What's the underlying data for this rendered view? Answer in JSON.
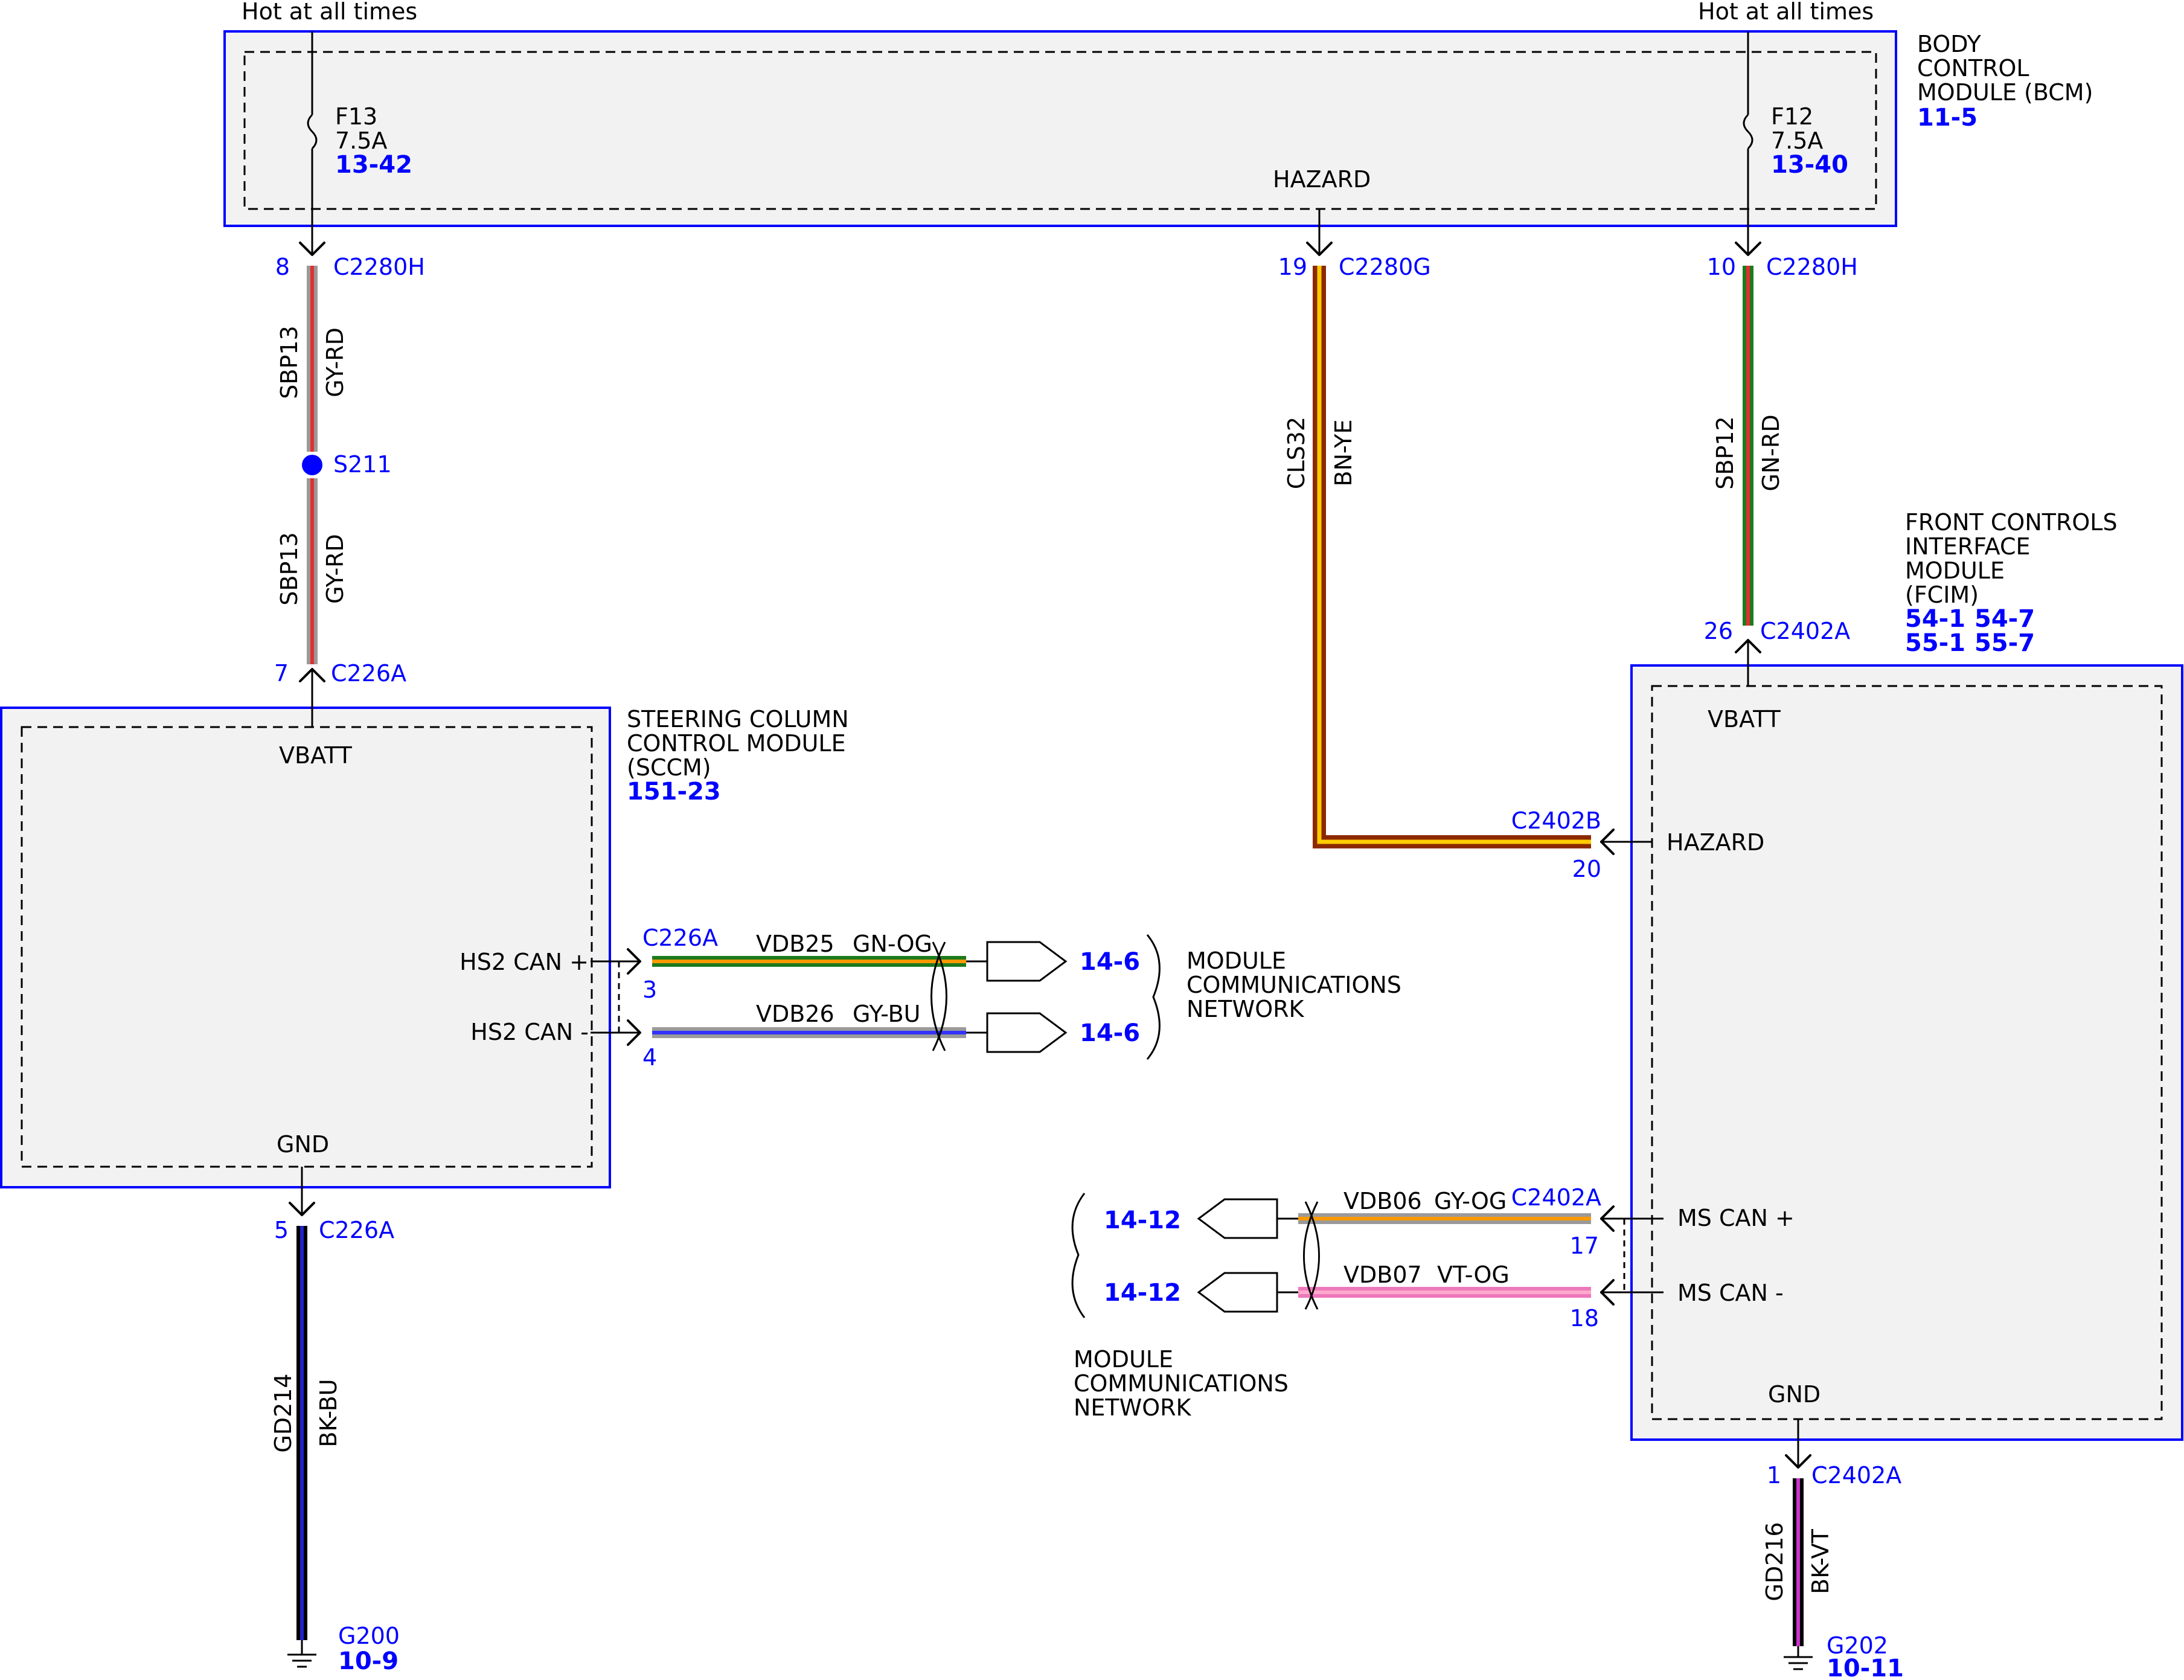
{
  "colors": {
    "module_border": "#0000ff",
    "module_fill": "#f2f2f2",
    "connector_text": "#0000ff",
    "wire_gy_rd": [
      "#9a9a9a",
      "#e03030"
    ],
    "wire_bn_ye": [
      "#8b2a00",
      "#ffcc00"
    ],
    "wire_gn_rd": [
      "#1d7a1d",
      "#e03030"
    ],
    "wire_gn_og": [
      "#1d7a1d",
      "#ff9900"
    ],
    "wire_gy_bu": [
      "#9a9a9a",
      "#3333ff"
    ],
    "wire_bk_bu": [
      "#000000",
      "#2222cc"
    ],
    "wire_gy_og": [
      "#9a9a9a",
      "#ff9900"
    ],
    "wire_vt_og": [
      "#ee77bb",
      "#ffaacc"
    ],
    "wire_bk_vt": [
      "#000000",
      "#cc33cc"
    ]
  },
  "hot_left": "Hot at all times",
  "hot_right": "Hot at all times",
  "bcm": {
    "name_l1": "BODY",
    "name_l2": "CONTROL",
    "name_l3": "MODULE (BCM)",
    "ref": "11-5",
    "fuse_left": {
      "id": "F13",
      "rating": "7.5A",
      "ref": "13-42"
    },
    "fuse_right": {
      "id": "F12",
      "rating": "7.5A",
      "ref": "13-40"
    },
    "hazard": "HAZARD"
  },
  "sccm": {
    "name_l1": "STEERING COLUMN",
    "name_l2": "CONTROL MODULE",
    "name_l3": "(SCCM)",
    "ref": "151-23",
    "vbatt": "VBATT",
    "hs2_can_plus": "HS2 CAN +",
    "hs2_can_minus": "HS2 CAN -",
    "gnd": "GND"
  },
  "fcim": {
    "name_l1": "FRONT CONTROLS",
    "name_l2": "INTERFACE",
    "name_l3": "MODULE",
    "name_l4": "(FCIM)",
    "refs": [
      "54-1",
      "54-7",
      "55-1",
      "55-7"
    ],
    "vbatt": "VBATT",
    "hazard": "HAZARD",
    "ms_can_plus": "MS CAN +",
    "ms_can_minus": "MS CAN -",
    "gnd": "GND"
  },
  "connectors": {
    "c2280h_left": {
      "pin": "8",
      "name": "C2280H"
    },
    "c2280g": {
      "pin": "19",
      "name": "C2280G"
    },
    "c2280h_right": {
      "pin": "10",
      "name": "C2280H"
    },
    "c226a_top": {
      "pin": "7",
      "name": "C226A"
    },
    "c226a_can": {
      "name": "C226A",
      "pin_plus": "3",
      "pin_minus": "4"
    },
    "c226a_gnd": {
      "pin": "5",
      "name": "C226A"
    },
    "c2402a_top": {
      "pin": "26",
      "name": "C2402A"
    },
    "c2402b": {
      "pin": "20",
      "name": "C2402B"
    },
    "c2402a_can": {
      "name": "C2402A",
      "pin_plus": "17",
      "pin_minus": "18"
    },
    "c2402a_gnd": {
      "pin": "1",
      "name": "C2402A"
    }
  },
  "splice": "S211",
  "wires": {
    "sbp13_upper": {
      "circuit": "SBP13",
      "color": "GY-RD"
    },
    "sbp13_lower": {
      "circuit": "SBP13",
      "color": "GY-RD"
    },
    "cls32": {
      "circuit": "CLS32",
      "color": "BN-YE"
    },
    "sbp12": {
      "circuit": "SBP12",
      "color": "GN-RD"
    },
    "vdb25": {
      "circuit": "VDB25",
      "color": "GN-OG"
    },
    "vdb26": {
      "circuit": "VDB26",
      "color": "GY-BU"
    },
    "vdb06": {
      "circuit": "VDB06",
      "color": "GY-OG"
    },
    "vdb07": {
      "circuit": "VDB07",
      "color": "VT-OG"
    },
    "gd214": {
      "circuit": "GD214",
      "color": "BK-BU"
    },
    "gd216": {
      "circuit": "GD216",
      "color": "BK-VT"
    }
  },
  "network_right": {
    "l1": "MODULE",
    "l2": "COMMUNICATIONS",
    "l3": "NETWORK",
    "ref_plus": "14-6",
    "ref_minus": "14-6"
  },
  "network_left": {
    "l1": "MODULE",
    "l2": "COMMUNICATIONS",
    "l3": "NETWORK",
    "ref_plus": "14-12",
    "ref_minus": "14-12"
  },
  "grounds": {
    "left": {
      "name": "G200",
      "ref": "10-9"
    },
    "right": {
      "name": "G202",
      "ref": "10-11"
    }
  }
}
